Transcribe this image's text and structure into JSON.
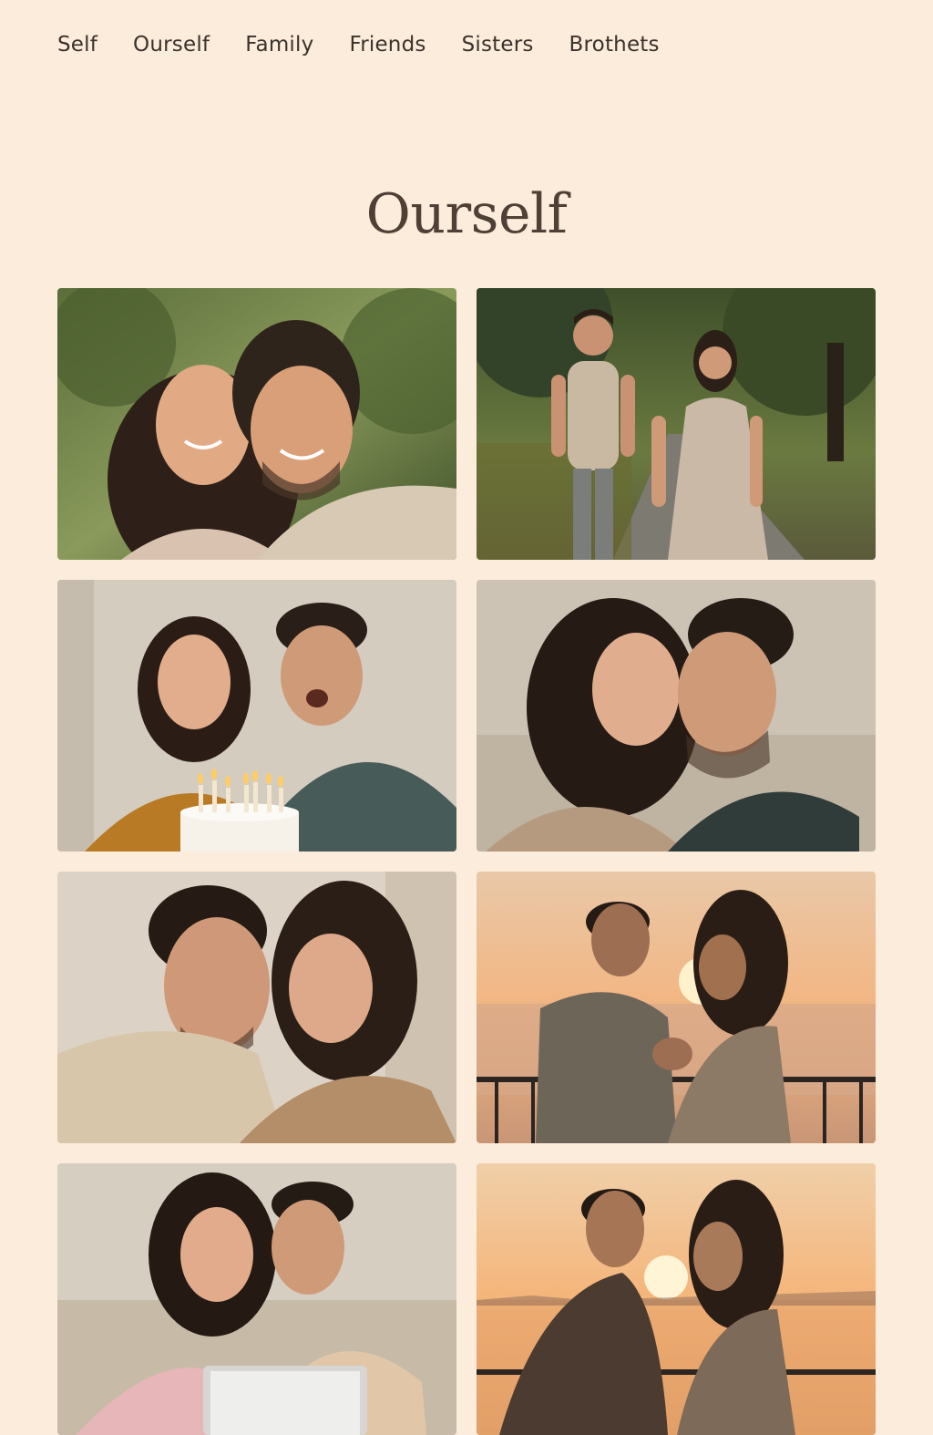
{
  "nav": {
    "items": [
      {
        "label": "Self"
      },
      {
        "label": "Ourself"
      },
      {
        "label": "Family"
      },
      {
        "label": "Friends"
      },
      {
        "label": "Sisters"
      },
      {
        "label": "Brothets"
      }
    ]
  },
  "page": {
    "title": "Ourself"
  },
  "gallery": {
    "photos": [
      {
        "scene": "selfie-park"
      },
      {
        "scene": "walking-park"
      },
      {
        "scene": "birthday-cake"
      },
      {
        "scene": "cheek-to-cheek"
      },
      {
        "scene": "forehead-touch"
      },
      {
        "scene": "sunset-pier"
      },
      {
        "scene": "laptop-couch"
      },
      {
        "scene": "sunset-lake"
      }
    ]
  }
}
